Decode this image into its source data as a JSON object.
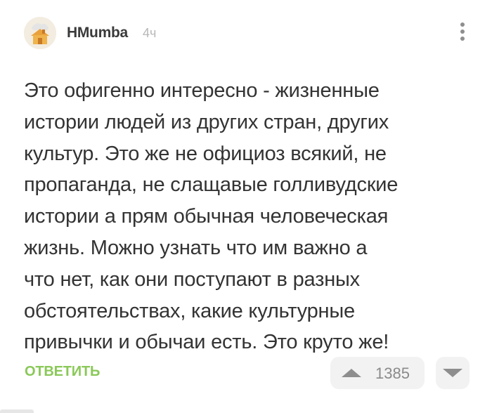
{
  "post": {
    "author": "HMumba",
    "time": "4ч",
    "avatar_icon": "house-avatar-icon",
    "comment_text": "Это офигенно интересно - жизненные\nистории людей из  других стран, других\nкультур. Это же не официоз всякий, не\nпропаганда, не слащавые голливудские\nистории а прям обычная человеческая\nжизнь. Можно узнать что им важно а\nчто нет, как они поступают в разных\nобстоятельствах, какие культурные\nпривычки и обычаи есть. Это круто же!"
  },
  "actions": {
    "reply_label": "ОТВЕТИТЬ",
    "rating": "1385",
    "upvote_icon": "triangle-up-icon",
    "downvote_icon": "triangle-down-icon",
    "more_icon": "more-vertical-icon"
  },
  "colors": {
    "accent_green": "#8ac858",
    "text": "#333333",
    "muted": "#b8b8b8",
    "button_bg": "#f2f2f2"
  }
}
